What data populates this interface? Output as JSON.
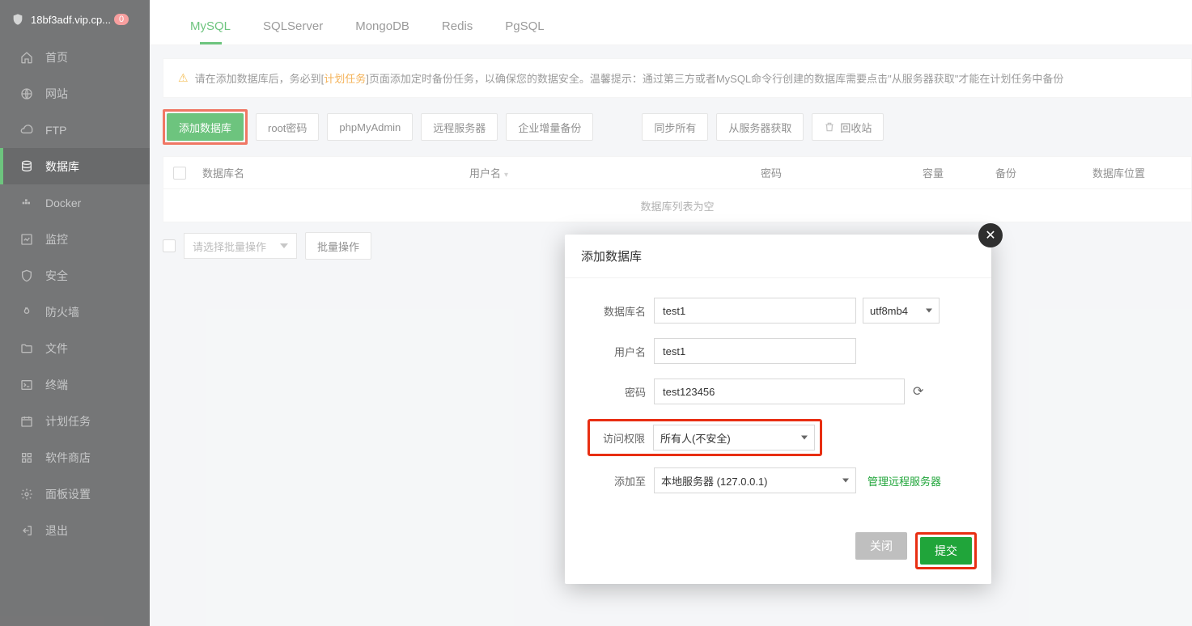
{
  "sidebar": {
    "host": "18bf3adf.vip.cp...",
    "badge": "0",
    "items": [
      {
        "label": "首页"
      },
      {
        "label": "网站"
      },
      {
        "label": "FTP"
      },
      {
        "label": "数据库"
      },
      {
        "label": "Docker"
      },
      {
        "label": "监控"
      },
      {
        "label": "安全"
      },
      {
        "label": "防火墙"
      },
      {
        "label": "文件"
      },
      {
        "label": "终端"
      },
      {
        "label": "计划任务"
      },
      {
        "label": "软件商店"
      },
      {
        "label": "面板设置"
      },
      {
        "label": "退出"
      }
    ]
  },
  "tabs": [
    "MySQL",
    "SQLServer",
    "MongoDB",
    "Redis",
    "PgSQL"
  ],
  "alert": {
    "prefix": "请在添加数据库后，务必到[",
    "link": "计划任务",
    "suffix": "]页面添加定时备份任务，以确保您的数据安全。温馨提示：通过第三方或者MySQL命令行创建的数据库需要点击\"从服务器获取\"才能在计划任务中备份"
  },
  "toolbar": {
    "add": "添加数据库",
    "rootpwd": "root密码",
    "phpmyadmin": "phpMyAdmin",
    "remote": "远程服务器",
    "entbackup": "企业增量备份",
    "syncall": "同步所有",
    "fromserver": "从服务器获取",
    "recycle": "回收站"
  },
  "table": {
    "headers": {
      "name": "数据库名",
      "user": "用户名",
      "pwd": "密码",
      "cap": "容量",
      "bak": "备份",
      "loc": "数据库位置"
    },
    "empty": "数据库列表为空"
  },
  "batch": {
    "placeholder": "请选择批量操作",
    "btn": "批量操作"
  },
  "modal": {
    "title": "添加数据库",
    "labels": {
      "dbname": "数据库名",
      "user": "用户名",
      "pwd": "密码",
      "access": "访问权限",
      "addto": "添加至"
    },
    "values": {
      "dbname": "test1",
      "user": "test1",
      "pwd": "test123456"
    },
    "charset": "utf8mb4",
    "access": "所有人(不安全)",
    "server": "本地服务器 (127.0.0.1)",
    "remote_link": "管理远程服务器",
    "cancel": "关闭",
    "ok": "提交"
  }
}
